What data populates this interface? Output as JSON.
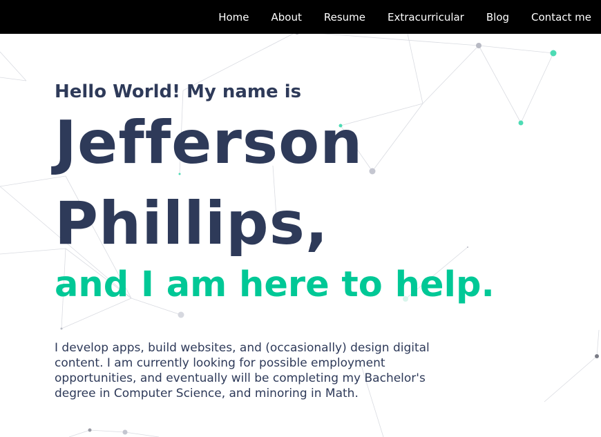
{
  "nav": {
    "items": [
      {
        "label": "Home"
      },
      {
        "label": "About"
      },
      {
        "label": "Resume"
      },
      {
        "label": "Extracurricular"
      },
      {
        "label": "Blog"
      },
      {
        "label": "Contact me"
      }
    ]
  },
  "hero": {
    "greeting": "Hello World! My name is",
    "name_first": "Jefferson",
    "name_last": "Phillips,",
    "tagline": "and I am here to help."
  },
  "bio": {
    "text": "I develop apps, build websites, and (occasionally) design digital content. I am currently looking for possible employment opportunities, and eventually will be completing my Bachelor's degree in Computer Science, and minoring in Math."
  },
  "colors": {
    "nav_background": "#000000",
    "nav_text": "#ffffff",
    "heading_text": "#2e3a59",
    "accent": "#00c896",
    "node_gray": "#c4c6d0",
    "node_teal": "#4ddbb4"
  }
}
